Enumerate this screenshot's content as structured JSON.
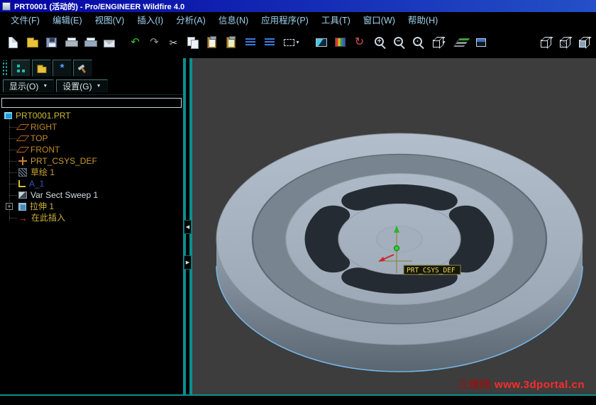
{
  "window": {
    "title": "PRT0001 (活动的) - Pro/ENGINEER Wildfire 4.0"
  },
  "menu": {
    "items": [
      {
        "label": "文件(F)"
      },
      {
        "label": "编辑(E)"
      },
      {
        "label": "视图(V)"
      },
      {
        "label": "插入(I)"
      },
      {
        "label": "分析(A)"
      },
      {
        "label": "信息(N)"
      },
      {
        "label": "应用程序(P)"
      },
      {
        "label": "工具(T)"
      },
      {
        "label": "窗口(W)"
      },
      {
        "label": "帮助(H)"
      }
    ]
  },
  "toolbar": {
    "buttons": [
      {
        "name": "new-file-icon"
      },
      {
        "name": "open-file-icon"
      },
      {
        "name": "save-icon"
      },
      {
        "name": "print-icon"
      },
      {
        "name": "plot-icon"
      },
      {
        "name": "send-email-icon"
      },
      {
        "name": "undo-icon",
        "glyph": "↶"
      },
      {
        "name": "redo-icon",
        "glyph": "↷"
      },
      {
        "name": "cut-icon",
        "glyph": "✂"
      },
      {
        "name": "copy-icon"
      },
      {
        "name": "paste-icon"
      },
      {
        "name": "paste-special-icon"
      },
      {
        "name": "item-list-icon"
      },
      {
        "name": "search-list-icon"
      },
      {
        "name": "selection-filter-icon",
        "caret": "▾"
      },
      {
        "name": "repaint-icon"
      },
      {
        "name": "shade-icon"
      },
      {
        "name": "spin-center-icon",
        "glyph": "↻"
      },
      {
        "name": "zoom-in-icon",
        "glyph": "+"
      },
      {
        "name": "zoom-out-icon",
        "glyph": "−"
      },
      {
        "name": "refit-icon",
        "glyph": "▪"
      },
      {
        "name": "saved-views-icon",
        "caret": "▾"
      },
      {
        "name": "layers-icon"
      },
      {
        "name": "view-manager-icon"
      },
      {
        "name": "wireframe-display-icon"
      },
      {
        "name": "hidden-line-display-icon"
      },
      {
        "name": "shaded-display-icon"
      }
    ]
  },
  "navigator": {
    "tabs": [
      {
        "name": "model-tree-tab"
      },
      {
        "name": "folder-browser-tab"
      },
      {
        "name": "favorites-tab",
        "glyph": "*"
      },
      {
        "name": "connections-tab"
      }
    ],
    "controls": [
      {
        "label": "显示(O)",
        "caret": "▼"
      },
      {
        "label": "设置(G)",
        "caret": "▼"
      }
    ]
  },
  "model_tree": {
    "items": [
      {
        "label": "PRT0001.PRT",
        "icon": "part-icon"
      },
      {
        "label": "RIGHT",
        "icon": "datum-plane-icon"
      },
      {
        "label": "TOP",
        "icon": "datum-plane-icon"
      },
      {
        "label": "FRONT",
        "icon": "datum-plane-icon"
      },
      {
        "label": "PRT_CSYS_DEF",
        "icon": "csys-icon"
      },
      {
        "label": "草绘 1",
        "icon": "sketch-icon"
      },
      {
        "label": "A_1",
        "icon": "axis-icon"
      },
      {
        "label": "Var Sect Sweep 1",
        "icon": "sweep-icon"
      },
      {
        "label": "拉伸 1",
        "icon": "extrude-icon",
        "expand_glyph": "+"
      },
      {
        "label": "在此插入",
        "icon": "insert-here-icon",
        "arrow_glyph": "→"
      }
    ]
  },
  "splitter": {
    "left_glyph": "◀",
    "right_glyph": "▶"
  },
  "graphics": {
    "csys_label": "PRT_CSYS_DEF"
  },
  "watermark": {
    "site_name": "三维网",
    "url_text": "www.3dportal.cn"
  },
  "colors": {
    "title_bar_blue": "#0a0aa8",
    "menu_text": "#9fd2f0",
    "teal_accent": "#0b8f8f",
    "tree_text_yellow": "#ccb136",
    "graphics_background": "#3d3d3d",
    "part_gray": "#a9b5c2",
    "watermark_red": "#ff2a2a",
    "csys_label_yellow": "#ecd95c"
  }
}
